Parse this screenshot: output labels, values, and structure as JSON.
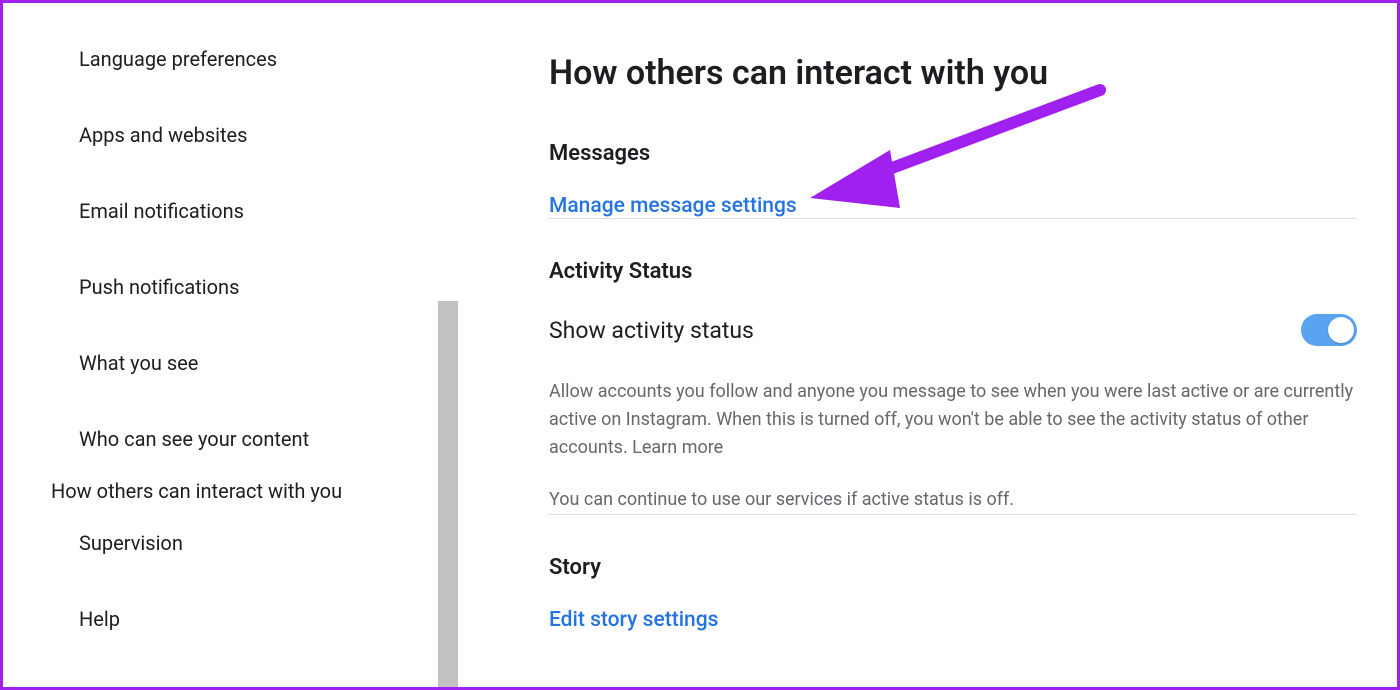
{
  "sidebar": {
    "items": [
      {
        "label": "Language preferences"
      },
      {
        "label": "Apps and websites"
      },
      {
        "label": "Email notifications"
      },
      {
        "label": "Push notifications"
      },
      {
        "label": "What you see"
      },
      {
        "label": "Who can see your content"
      },
      {
        "label": "How others can interact with you",
        "active": true
      },
      {
        "label": "Supervision"
      },
      {
        "label": "Help"
      }
    ]
  },
  "main": {
    "title": "How others can interact with you",
    "messages": {
      "heading": "Messages",
      "link": "Manage message settings"
    },
    "activity": {
      "heading": "Activity Status",
      "toggle_label": "Show activity status",
      "toggle_on": true,
      "desc1": "Allow accounts you follow and anyone you message to see when you were last active or are currently active on Instagram. When this is turned off, you won't be able to see the activity status of other accounts. Learn more",
      "desc2": "You can continue to use our services if active status is off."
    },
    "story": {
      "heading": "Story",
      "link": "Edit story settings"
    }
  },
  "annotation": {
    "arrow_color": "#a020f0"
  }
}
